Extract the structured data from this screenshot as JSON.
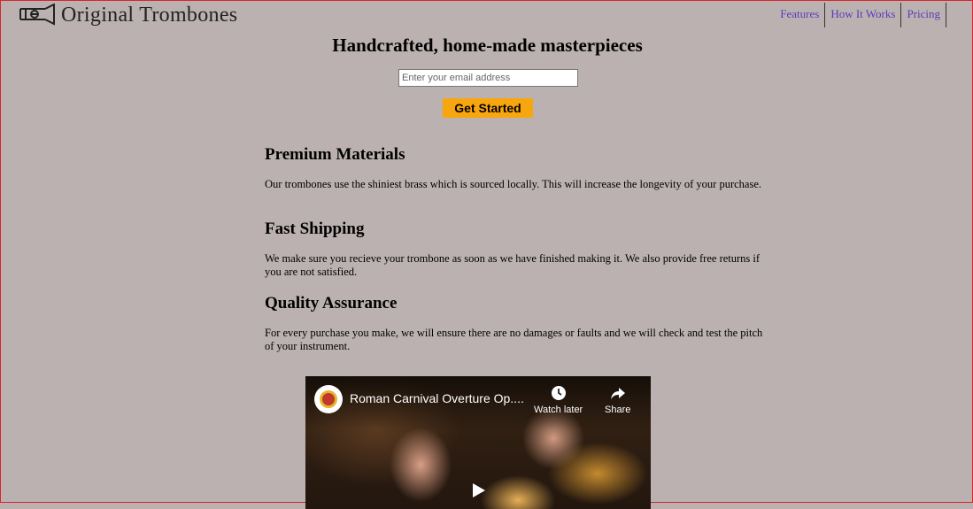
{
  "header": {
    "logo_text": "Original Trombones",
    "logo_icon": "trombone-icon",
    "nav": [
      {
        "label": "Features"
      },
      {
        "label": "How It Works"
      },
      {
        "label": "Pricing"
      }
    ]
  },
  "hero": {
    "title": "Handcrafted, home-made masterpieces",
    "email_placeholder": "Enter your email address",
    "cta_label": "Get Started",
    "cta_color": "#f8a60e"
  },
  "features": [
    {
      "title": "Premium Materials",
      "text": "Our trombones use the shiniest brass which is sourced locally. This will increase the longevity of your purchase."
    },
    {
      "title": "Fast Shipping",
      "text": "We make sure you recieve your trombone as soon as we have finished making it. We also provide free returns if you are not satisfied."
    },
    {
      "title": "Quality Assurance",
      "text": "For every purchase you make, we will ensure there are no damages or faults and we will check and test the pitch of your instrument."
    }
  ],
  "video": {
    "title": "Roman Carnival Overture Op....",
    "watch_later_label": "Watch later",
    "share_label": "Share"
  },
  "colors": {
    "background": "#bcb1b1",
    "nav_link": "#5a3bbd"
  }
}
